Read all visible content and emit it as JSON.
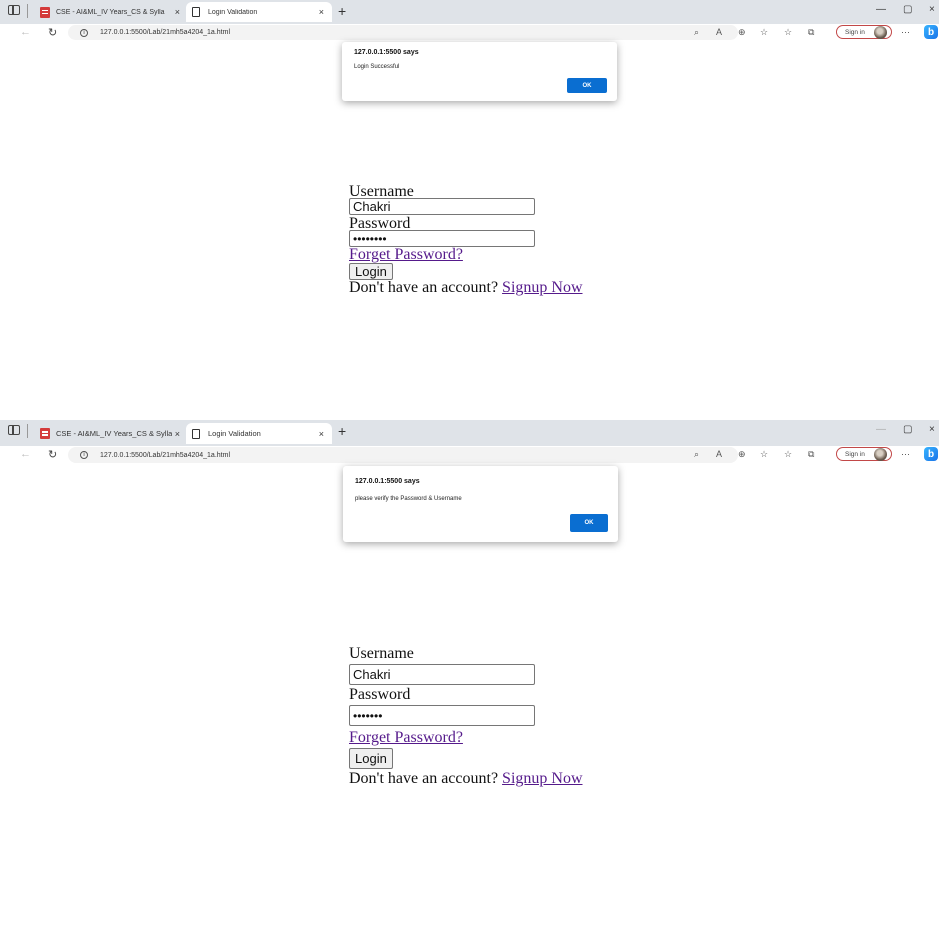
{
  "screenshots": [
    {
      "browser": {
        "tabs": [
          {
            "title": "CSE - AI&ML_IV Years_CS & Sylla",
            "close": "×"
          },
          {
            "title": "Login Validation",
            "close": "×"
          }
        ],
        "new_tab": "+",
        "window_controls": [
          "—",
          "▢",
          "×"
        ],
        "url": "127.0.0.1:5500/Lab/21mh5a4204_1a.html",
        "sign_in": "Sign in",
        "bing": "b"
      },
      "dialog": {
        "title": "127.0.0.1:5500 says",
        "message": "Login Successful",
        "ok": "OK"
      },
      "form": {
        "username_label": "Username",
        "username_value": "Chakri",
        "password_label": "Password",
        "password_value": "••••••••",
        "forgot_link": "Forget Password?",
        "login_button": "Login",
        "signup_prompt": "Don't have an account? ",
        "signup_link": "Signup Now"
      }
    },
    {
      "browser": {
        "tabs": [
          {
            "title": "CSE - AI&ML_IV Years_CS & Sylla",
            "close": "×"
          },
          {
            "title": "Login Validation",
            "close": "×"
          }
        ],
        "new_tab": "+",
        "window_controls": [
          "—",
          "▢",
          "×"
        ],
        "url": "127.0.0.1:5500/Lab/21mh5a4204_1a.html",
        "sign_in": "Sign in",
        "bing": "b"
      },
      "dialog": {
        "title": "127.0.0.1:5500 says",
        "message": "please verify the Password & Username",
        "ok": "OK"
      },
      "form": {
        "username_label": "Username",
        "username_value": "Chakri",
        "password_label": "Password",
        "password_value": "•••••••",
        "forgot_link": "Forget Password?",
        "login_button": "Login",
        "signup_prompt": "Don't have an account? ",
        "signup_link": "Signup Now"
      }
    }
  ]
}
